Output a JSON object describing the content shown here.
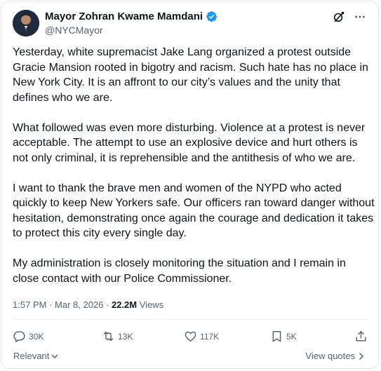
{
  "author": {
    "display_name": "Mayor Zohran Kwame Mamdani",
    "handle": "@NYCMayor",
    "verified": true
  },
  "tweet": {
    "paragraphs": [
      "Yesterday, white supremacist Jake Lang organized a protest outside Gracie Mansion rooted in bigotry and racism. Such hate has no place in New York City. It is an affront to our city’s values and the unity that defines who we are.",
      "What followed was even more disturbing. Violence at a protest is never acceptable. The attempt to use an explosive device and hurt others is not only criminal, it is reprehensible and the antithesis of who we are.",
      "I want to thank the brave men and women of the NYPD who acted quickly to keep New Yorkers safe. Our officers ran toward danger without hesitation, demonstrating once again the courage and dedication it takes to protect this city every single day.",
      "My administration is closely monitoring the situation and I remain in close contact with our Police Commissioner."
    ],
    "time": "1:57 PM",
    "separator": "·",
    "date": "Mar 8, 2026",
    "views_count": "22.2M",
    "views_label": "Views"
  },
  "actions": {
    "replies": "30K",
    "reposts": "13K",
    "likes": "117K",
    "bookmarks": "5K"
  },
  "footer": {
    "sort_label": "Relevant",
    "view_quotes_label": "View quotes"
  },
  "colors": {
    "verified_blue": "#1d9bf0",
    "text_primary": "#0f1419",
    "text_secondary": "#536471"
  }
}
